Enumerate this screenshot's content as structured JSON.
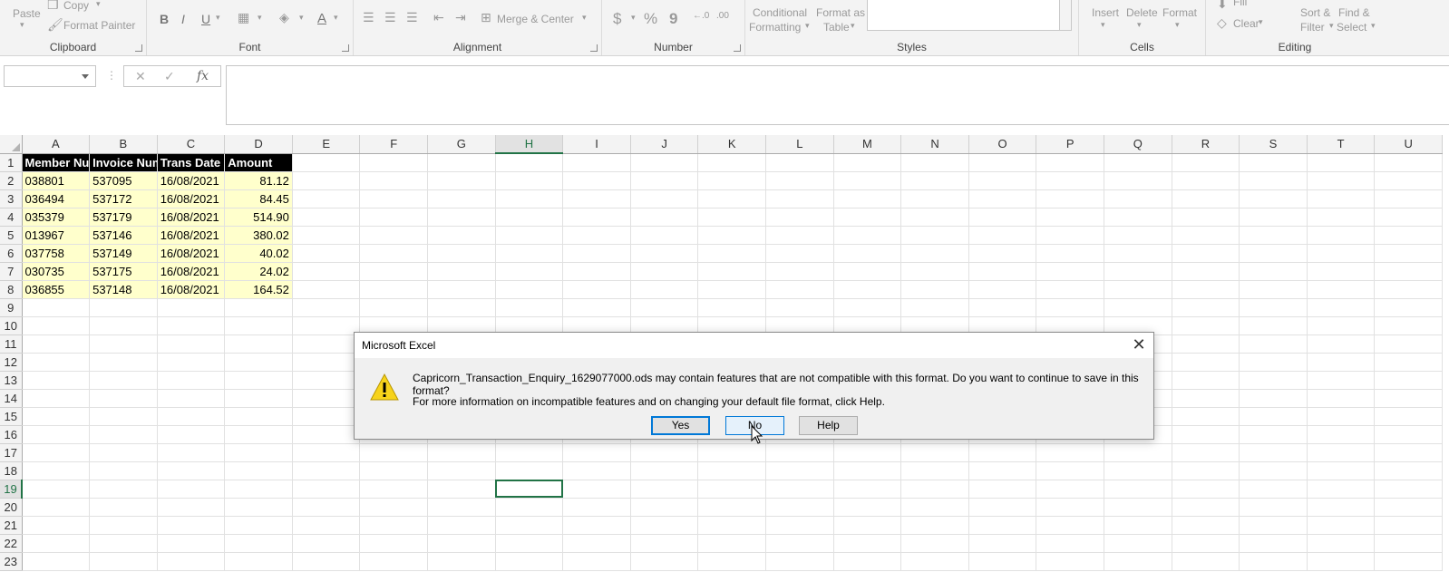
{
  "ribbon": {
    "clipboard": {
      "label": "Clipboard",
      "paste": "Paste",
      "copy": "Copy",
      "format_painter": "Format Painter"
    },
    "font": {
      "label": "Font",
      "bold": "B",
      "italic": "I",
      "underline": "U",
      "font_color": "A"
    },
    "alignment": {
      "label": "Alignment",
      "merge_center": "Merge & Center"
    },
    "number": {
      "label": "Number",
      "currency": "$",
      "percent": "%",
      "comma": "9"
    },
    "styles": {
      "label": "Styles",
      "conditional": "Conditional",
      "formatting": "Formatting",
      "format_as": "Format as",
      "table": "Table"
    },
    "cells": {
      "label": "Cells",
      "insert": "Insert",
      "delete": "Delete",
      "format": "Format"
    },
    "editing": {
      "label": "Editing",
      "fill": "Fill",
      "clear": "Clear",
      "sort": "Sort &",
      "filter": "Filter",
      "find": "Find &",
      "select": "Select"
    }
  },
  "formula_bar": {
    "name_box": "",
    "formula": "",
    "fx": "fx"
  },
  "sheet": {
    "columns": [
      "A",
      "B",
      "C",
      "D",
      "E",
      "F",
      "G",
      "H",
      "I",
      "J",
      "K",
      "L",
      "M",
      "N",
      "O",
      "P",
      "Q",
      "R",
      "S",
      "T",
      "U"
    ],
    "rows": [
      "1",
      "2",
      "3",
      "4",
      "5",
      "6",
      "7",
      "8",
      "9",
      "10",
      "11",
      "12",
      "13",
      "14",
      "15",
      "16",
      "17",
      "18",
      "19",
      "20",
      "21",
      "22",
      "23"
    ],
    "selected_column": "H",
    "selected_row": "19",
    "header": [
      "Member Number",
      "Invoice Number",
      "Trans Date",
      "Amount"
    ],
    "data": [
      [
        "038801",
        "537095",
        "16/08/2021",
        "81.12"
      ],
      [
        "036494",
        "537172",
        "16/08/2021",
        "84.45"
      ],
      [
        "035379",
        "537179",
        "16/08/2021",
        "514.90"
      ],
      [
        "013967",
        "537146",
        "16/08/2021",
        "380.02"
      ],
      [
        "037758",
        "537149",
        "16/08/2021",
        "40.02"
      ],
      [
        "030735",
        "537175",
        "16/08/2021",
        "24.02"
      ],
      [
        "036855",
        "537148",
        "16/08/2021",
        "164.52"
      ]
    ]
  },
  "dialog": {
    "title": "Microsoft Excel",
    "close": "✕",
    "message": "Capricorn_Transaction_Enquiry_1629077000.ods may contain features that are not compatible with this format.  Do you want to continue to save in this format?",
    "info": "For more information on incompatible features and on changing your default file format, click Help.",
    "yes": "Yes",
    "no": "No",
    "help": "Help"
  }
}
